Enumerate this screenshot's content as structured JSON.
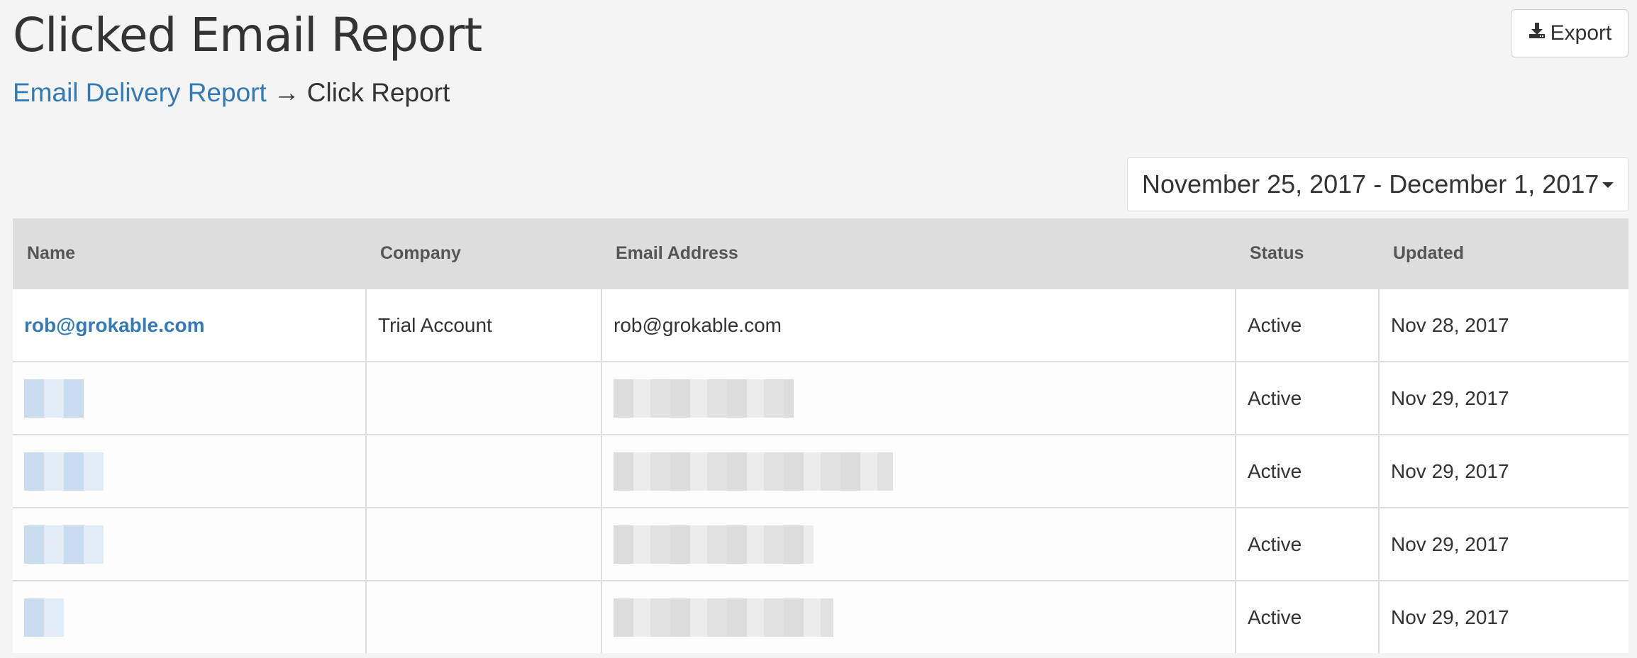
{
  "header": {
    "title": "Clicked Email Report",
    "export_label": "Export"
  },
  "breadcrumb": {
    "parent": "Email Delivery Report",
    "separator": "→",
    "current": "Click Report"
  },
  "date_range": {
    "value": "November 25, 2017 - December 1, 2017"
  },
  "table": {
    "columns": [
      "Name",
      "Company",
      "Email Address",
      "Status",
      "Updated"
    ],
    "rows": [
      {
        "name": "rob@grokable.com",
        "company": "Trial Account",
        "email": "rob@grokable.com",
        "status": "Active",
        "updated": "Nov 28, 2017"
      },
      {
        "name": "",
        "company": "",
        "email": "",
        "status": "Active",
        "updated": "Nov 29, 2017"
      },
      {
        "name": "",
        "company": "",
        "email": "",
        "status": "Active",
        "updated": "Nov 29, 2017"
      },
      {
        "name": "",
        "company": "",
        "email": "",
        "status": "Active",
        "updated": "Nov 29, 2017"
      },
      {
        "name": "",
        "company": "",
        "email": "",
        "status": "Active",
        "updated": "Nov 29, 2017"
      }
    ]
  },
  "colors": {
    "link": "#337ab7",
    "header_bg": "#dddddd",
    "page_bg": "#f4f4f4"
  }
}
